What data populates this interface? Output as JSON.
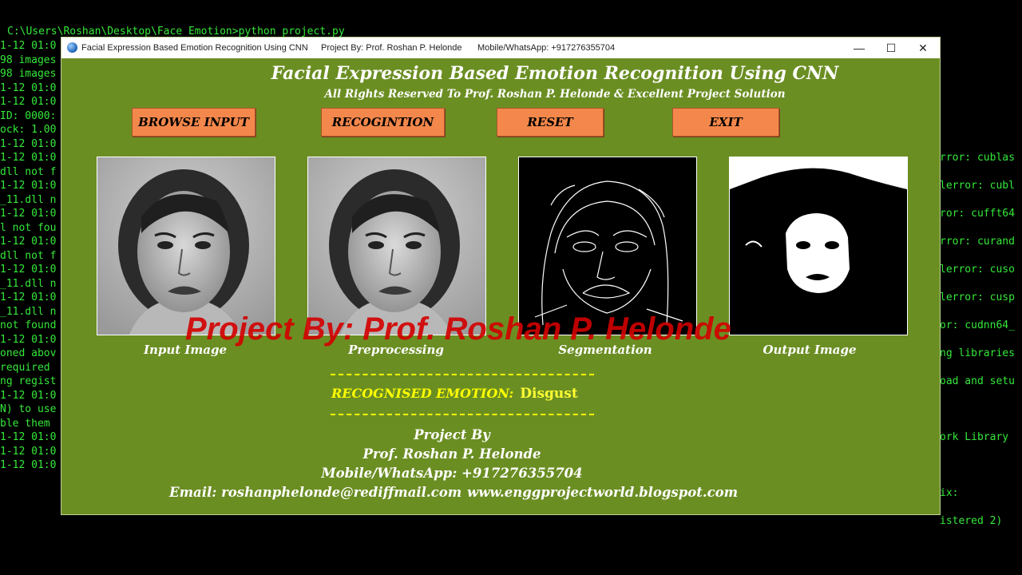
{
  "terminal": {
    "command_line": "C:\\Users\\Roshan\\Desktop\\Face Emotion>python project.py",
    "left_lines": [
      "1-12 01:0",
      "98 images",
      "98 images",
      "1-12 01:0",
      "1-12 01:0",
      "ID: 0000:",
      "ock: 1.00",
      "1-12 01:0",
      "1-12 01:0",
      "dll not f",
      "1-12 01:0",
      "_11.dll n",
      "1-12 01:0",
      "l not fou",
      "1-12 01:0",
      "dll not f",
      "1-12 01:0",
      "_11.dll n",
      "1-12 01:0",
      "_11.dll n",
      "not found",
      "1-12 01:0",
      "oned abov",
      "required ",
      "ng regist",
      "1-12 01:0",
      "N) to use",
      "ble them ",
      "1-12 01:0",
      "1-12 01:0",
      "1-12 01:0"
    ],
    "right_lines": [
      "rror: cublas",
      "lerror: cubl",
      "ror: cufft64",
      "rror: curand",
      "lerror: cuso",
      "lerror: cusp",
      "or: cudnn64_",
      "ng libraries",
      "oad and setu",
      "",
      "ork Library",
      "",
      "ix:",
      "istered 2)"
    ]
  },
  "window": {
    "title": "Facial Expression Based Emotion Recognition Using CNN",
    "title_extra_1": "Project By: Prof. Roshan P. Helonde",
    "title_extra_2": "Mobile/WhatsApp: +917276355704",
    "controls": {
      "minimize": "—",
      "maximize": "☐",
      "close": "✕"
    }
  },
  "app": {
    "heading": "Facial Expression Based Emotion Recognition Using CNN",
    "subheading": "All Rights Reserved To Prof. Roshan P. Helonde & Excellent Project Solution",
    "buttons": {
      "browse": "BROWSE INPUT",
      "recognize": "RECOGINTION",
      "reset": "RESET",
      "exit": "EXIT"
    },
    "panels": {
      "input": "Input Image",
      "preprocessing": "Preprocessing",
      "segmentation": "Segmentation",
      "output": "Output Image"
    },
    "result_label": "RECOGNISED EMOTION:",
    "result_value": "Disgust",
    "footer": {
      "line1": "Project By",
      "line2": "Prof. Roshan P. Helonde",
      "line3": "Mobile/WhatsApp: +917276355704",
      "email": "Email: roshanphelonde@rediffmail.com",
      "website": "www.enggprojectworld.blogspot.com"
    },
    "watermark": "Project By: Prof. Roshan P. Helonde"
  },
  "colors": {
    "window_bg": "#6b8e23",
    "button_bg": "#f4874b",
    "highlight": "#ffff00",
    "watermark": "#d40000",
    "terminal_text": "#35e83a"
  }
}
